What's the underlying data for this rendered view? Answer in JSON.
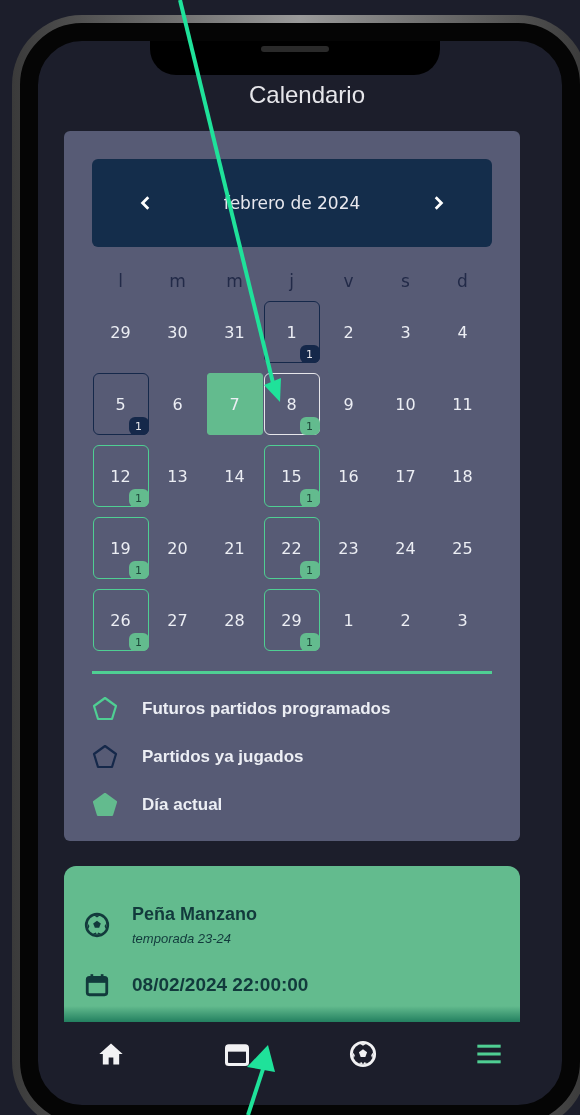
{
  "screen": {
    "title": "Calendario"
  },
  "calendar": {
    "month": "febrero de 2024",
    "weekdays": [
      "l",
      "m",
      "m",
      "j",
      "v",
      "s",
      "d"
    ],
    "weeks": [
      [
        {
          "day": "29",
          "kind": "plain",
          "today": false,
          "selected": false
        },
        {
          "day": "30",
          "kind": "plain",
          "today": false,
          "selected": false
        },
        {
          "day": "31",
          "kind": "plain",
          "today": false,
          "selected": false
        },
        {
          "day": "1",
          "kind": "played",
          "count": "1",
          "today": false,
          "selected": false
        },
        {
          "day": "2",
          "kind": "plain",
          "today": false,
          "selected": false
        },
        {
          "day": "3",
          "kind": "plain",
          "today": false,
          "selected": false
        },
        {
          "day": "4",
          "kind": "plain",
          "today": false,
          "selected": false
        }
      ],
      [
        {
          "day": "5",
          "kind": "played",
          "count": "1",
          "today": false,
          "selected": false
        },
        {
          "day": "6",
          "kind": "plain",
          "today": false,
          "selected": false
        },
        {
          "day": "7",
          "kind": "plain",
          "today": true,
          "selected": false
        },
        {
          "day": "8",
          "kind": "scheduled",
          "count": "1",
          "today": false,
          "selected": true
        },
        {
          "day": "9",
          "kind": "plain",
          "today": false,
          "selected": false
        },
        {
          "day": "10",
          "kind": "plain",
          "today": false,
          "selected": false
        },
        {
          "day": "11",
          "kind": "plain",
          "today": false,
          "selected": false
        }
      ],
      [
        {
          "day": "12",
          "kind": "scheduled",
          "count": "1",
          "today": false,
          "selected": false
        },
        {
          "day": "13",
          "kind": "plain",
          "today": false,
          "selected": false
        },
        {
          "day": "14",
          "kind": "plain",
          "today": false,
          "selected": false
        },
        {
          "day": "15",
          "kind": "scheduled",
          "count": "1",
          "today": false,
          "selected": false
        },
        {
          "day": "16",
          "kind": "plain",
          "today": false,
          "selected": false
        },
        {
          "day": "17",
          "kind": "plain",
          "today": false,
          "selected": false
        },
        {
          "day": "18",
          "kind": "plain",
          "today": false,
          "selected": false
        }
      ],
      [
        {
          "day": "19",
          "kind": "scheduled",
          "count": "1",
          "today": false,
          "selected": false
        },
        {
          "day": "20",
          "kind": "plain",
          "today": false,
          "selected": false
        },
        {
          "day": "21",
          "kind": "plain",
          "today": false,
          "selected": false
        },
        {
          "day": "22",
          "kind": "scheduled",
          "count": "1",
          "today": false,
          "selected": false
        },
        {
          "day": "23",
          "kind": "plain",
          "today": false,
          "selected": false
        },
        {
          "day": "24",
          "kind": "plain",
          "today": false,
          "selected": false
        },
        {
          "day": "25",
          "kind": "plain",
          "today": false,
          "selected": false
        }
      ],
      [
        {
          "day": "26",
          "kind": "scheduled",
          "count": "1",
          "today": false,
          "selected": false
        },
        {
          "day": "27",
          "kind": "plain",
          "today": false,
          "selected": false
        },
        {
          "day": "28",
          "kind": "plain",
          "today": false,
          "selected": false
        },
        {
          "day": "29",
          "kind": "scheduled",
          "count": "1",
          "today": false,
          "selected": false
        },
        {
          "day": "1",
          "kind": "plain",
          "today": false,
          "selected": false
        },
        {
          "day": "2",
          "kind": "plain",
          "today": false,
          "selected": false
        },
        {
          "day": "3",
          "kind": "plain",
          "today": false,
          "selected": false
        }
      ]
    ]
  },
  "legend": [
    {
      "kind": "scheduled",
      "label": "Futuros partidos programados"
    },
    {
      "kind": "played",
      "label": "Partidos ya jugados"
    },
    {
      "kind": "today",
      "label": "Día actual"
    }
  ],
  "match_card": {
    "team": "Peña Manzano",
    "season": "temporada 23-24",
    "datetime": "08/02/2024 22:00:00"
  },
  "nav": [
    {
      "kind": "home",
      "selected": false
    },
    {
      "kind": "calendar",
      "selected": false
    },
    {
      "kind": "ball",
      "selected": false
    },
    {
      "kind": "menu",
      "selected": true
    }
  ]
}
